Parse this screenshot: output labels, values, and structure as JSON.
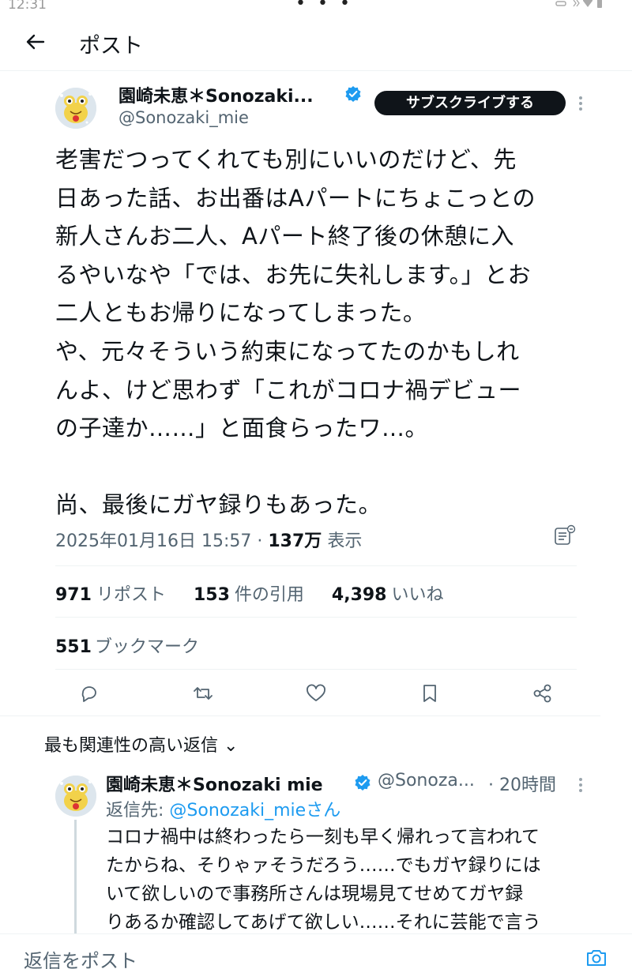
{
  "status_bar": {
    "time": "12:31",
    "dots": "• • •"
  },
  "nav": {
    "title": "ポスト"
  },
  "tweet": {
    "author_name": "園崎未恵＊Sonozaki...",
    "handle": "@Sonozaki_mie",
    "subscribe_label": "サブスクライブする",
    "text": "老害だつってくれても別にいいのだけど、先\n日あった話、お出番はAパートにちょこっとの\n新人さんお二人、Aパート終了後の休憩に入\nるやいなや「では、お先に失礼します。」とお\n二人ともお帰りになってしまった。\nや、元々そういう約束になってたのかもしれ\nんよ、けど思わず「これがコロナ禍デビュー\nの子達か……」と面食らったワ…。\n\n尚、最後にガヤ録りもあった。",
    "timestamp": "2025年01月16日 15:57",
    "views_count": "137万",
    "views_label": "表示"
  },
  "stats": {
    "reposts_count": "971",
    "reposts_label": "リポスト",
    "quotes_count": "153",
    "quotes_label": "件の引用",
    "likes_count": "4,398",
    "likes_label": "いいね",
    "bookmarks_count": "551",
    "bookmarks_label": "ブックマーク"
  },
  "actions": [
    "reply-icon",
    "repost-icon",
    "like-icon",
    "bookmark-icon",
    "share-icon"
  ],
  "replies": {
    "section_label": "最も関連性の高い返信 ⌄",
    "items": [
      {
        "author_name": "園崎未恵＊Sonozaki mie",
        "handle": "@Sonoza...",
        "time": "· 20時間",
        "reply_to_prefix": "返信先: ",
        "reply_to_link": "@Sonozaki_mieさん",
        "text": "コロナ禍中は終わったら一刻も早く帰れって言われて\nたからね、そりゃァそうだろう……でもガヤ録りには\nいて欲しいので事務所さんは現場見てせめてガヤ録\nりあるか確認してあげて欲しい……それに芸能で言う"
      }
    ]
  },
  "composer": {
    "placeholder": "返信をポスト"
  },
  "colors": {
    "accent": "#1d9bf0",
    "text": "#0f1419",
    "secondary": "#536471",
    "divider": "#eff3f4"
  }
}
